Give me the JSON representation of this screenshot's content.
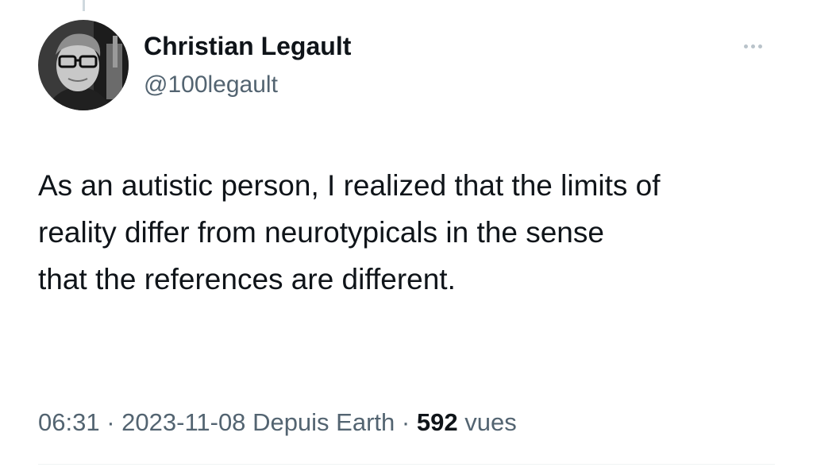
{
  "author": {
    "name": "Christian Legault",
    "handle": "@100legault",
    "avatar_icon": "profile-photo"
  },
  "more_icon": "more-horizontal-icon",
  "tweet": {
    "lines": [
      "As an autistic person, I realized that the limits of",
      "reality differ from neurotypicals in the sense",
      "that the references are different."
    ]
  },
  "meta": {
    "time": "06:31",
    "separator": "·",
    "date": "2023-11-08",
    "source": "Depuis Earth",
    "views_count": "592",
    "views_label": "vues"
  },
  "colors": {
    "text_primary": "#0f1419",
    "text_secondary": "#536471",
    "divider": "#eff3f4"
  }
}
